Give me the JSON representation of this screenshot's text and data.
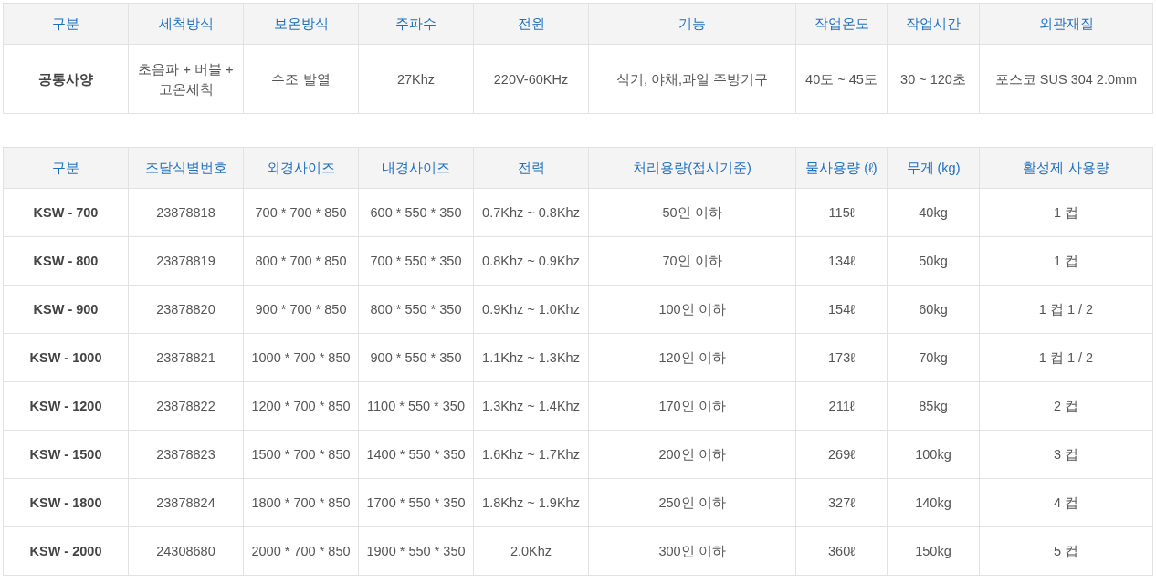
{
  "common_spec": {
    "columns": [
      "구분",
      "세척방식",
      "보온방식",
      "주파수",
      "전원",
      "기능",
      "작업온도",
      "작업시간",
      "외관재질"
    ],
    "rows": [
      [
        "공통사양",
        "초음파 + 버블 + 고온세척",
        "수조 발열",
        "27Khz",
        "220V-60KHz",
        "식기, 야채,과일 주방기구",
        "40도 ~ 45도",
        "30 ~ 120초",
        "포스코 SUS 304 2.0mm"
      ]
    ]
  },
  "models": {
    "columns": [
      "구분",
      "조달식별번호",
      "외경사이즈",
      "내경사이즈",
      "전력",
      "처리용량(접시기준)",
      "물사용량 (ℓ)",
      "무게 (kg)",
      "활성제 사용량"
    ],
    "rows": [
      [
        "KSW - 700",
        "23878818",
        "700 * 700 * 850",
        "600 * 550 * 350",
        "0.7Khz ~ 0.8Khz",
        "50인 이하",
        "115ℓ",
        "40kg",
        "1 컵"
      ],
      [
        "KSW - 800",
        "23878819",
        "800 * 700 * 850",
        "700 * 550 * 350",
        "0.8Khz ~ 0.9Khz",
        "70인 이하",
        "134ℓ",
        "50kg",
        "1 컵"
      ],
      [
        "KSW - 900",
        "23878820",
        "900 * 700 * 850",
        "800 * 550 * 350",
        "0.9Khz ~ 1.0Khz",
        "100인 이하",
        "154ℓ",
        "60kg",
        "1 컵 1 / 2"
      ],
      [
        "KSW - 1000",
        "23878821",
        "1000 * 700 * 850",
        "900 * 550 * 350",
        "1.1Khz ~ 1.3Khz",
        "120인 이하",
        "173ℓ",
        "70kg",
        "1 컵 1 / 2"
      ],
      [
        "KSW - 1200",
        "23878822",
        "1200 * 700 * 850",
        "1100 * 550 * 350",
        "1.3Khz ~ 1.4Khz",
        "170인 이하",
        "211ℓ",
        "85kg",
        "2 컵"
      ],
      [
        "KSW - 1500",
        "23878823",
        "1500 * 700 * 850",
        "1400 * 550 * 350",
        "1.6Khz ~ 1.7Khz",
        "200인 이하",
        "269ℓ",
        "100kg",
        "3 컵"
      ],
      [
        "KSW - 1800",
        "23878824",
        "1800 * 700 * 850",
        "1700 * 550 * 350",
        "1.8Khz ~ 1.9Khz",
        "250인 이하",
        "327ℓ",
        "140kg",
        "4 컵"
      ],
      [
        "KSW - 2000",
        "24308680",
        "2000 * 700 * 850",
        "1900 * 550 * 350",
        "2.0Khz",
        "300인 이하",
        "360ℓ",
        "150kg",
        "5 컵"
      ]
    ]
  }
}
